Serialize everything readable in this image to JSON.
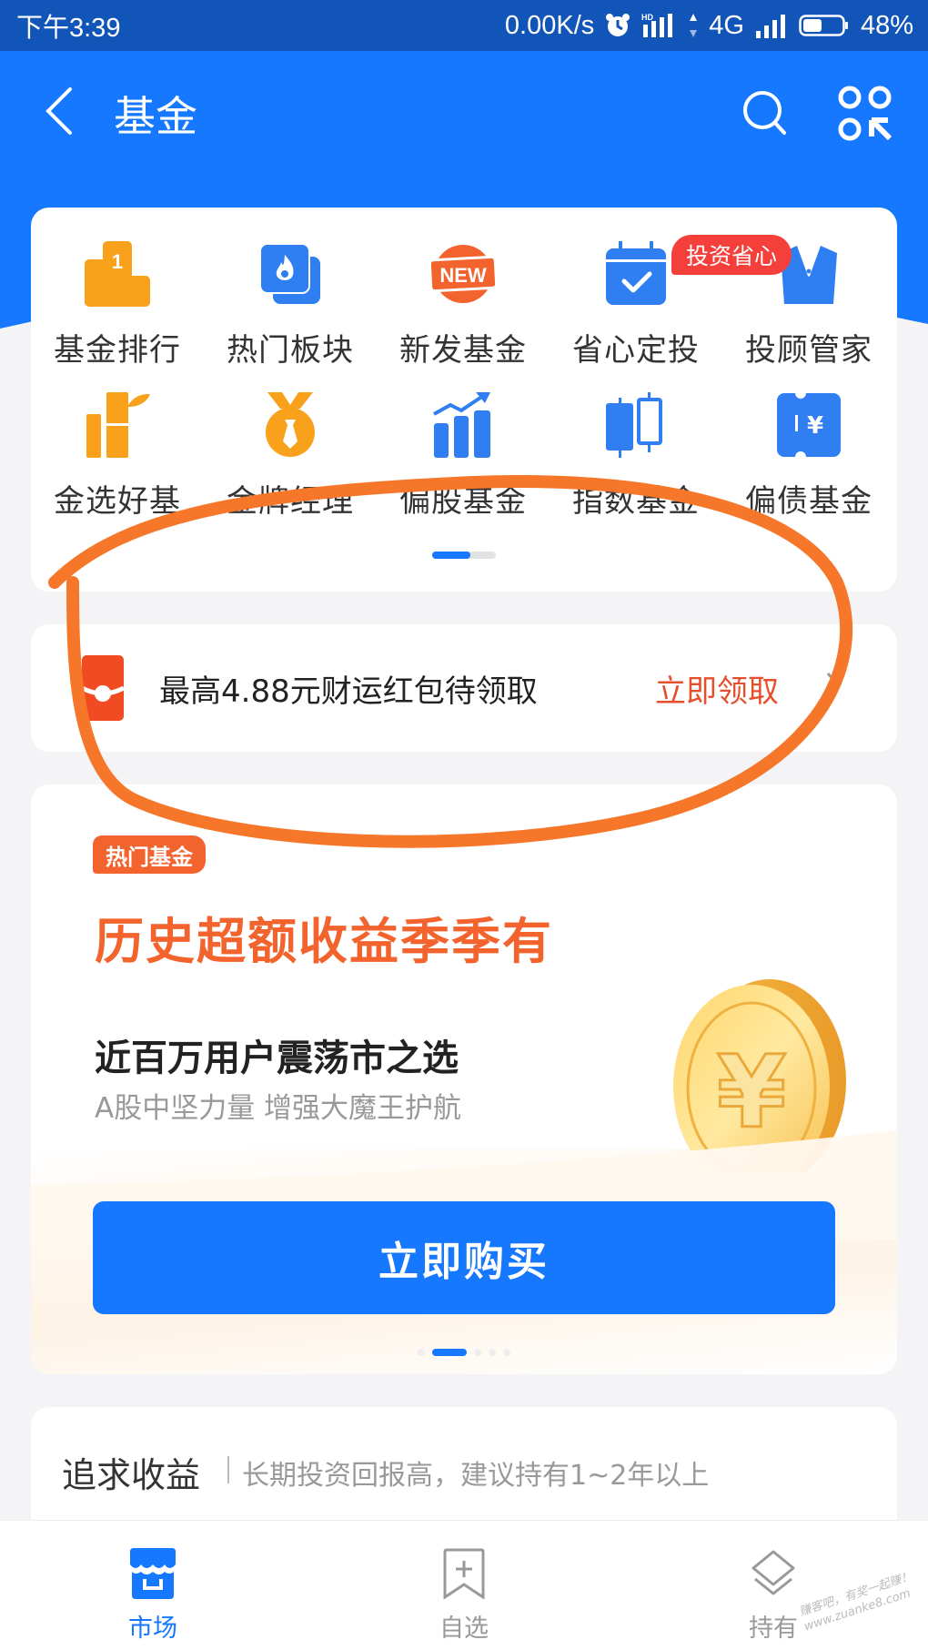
{
  "status_bar": {
    "time": "下午3:39",
    "net_speed": "0.00K/s",
    "network_type": "4G",
    "battery_percent": "48%",
    "battery_level": 0.48,
    "icons": [
      "alarm-icon",
      "hd-signal-icon",
      "data-arrows-icon",
      "signal-icon",
      "battery-icon"
    ]
  },
  "nav": {
    "title": "基金",
    "back_icon": "chevron-left-icon",
    "search_icon": "search-icon",
    "apps_icon": "apps-grid-icon"
  },
  "colors": {
    "brand_blue": "#1677ff",
    "accent_orange": "#f2632d",
    "badge_red": "#f43f3b",
    "icon_orange": "#f9a11b"
  },
  "quick_grid": {
    "badge": "投资省心",
    "page_indicator": {
      "pages": 2,
      "active": 1
    },
    "items": [
      {
        "label": "基金排行",
        "icon": "podium-rank-icon"
      },
      {
        "label": "热门板块",
        "icon": "flame-cards-icon"
      },
      {
        "label": "新发基金",
        "icon": "new-badge-icon",
        "icon_text": "NEW"
      },
      {
        "label": "省心定投",
        "icon": "calendar-check-icon"
      },
      {
        "label": "投顾管家",
        "icon": "suit-vest-icon"
      },
      {
        "label": "金选好基",
        "icon": "bamboo-icon"
      },
      {
        "label": "金牌经理",
        "icon": "medal-tie-icon"
      },
      {
        "label": "偏股基金",
        "icon": "bar-trend-icon"
      },
      {
        "label": "指数基金",
        "icon": "candlestick-icon"
      },
      {
        "label": "偏债基金",
        "icon": "yuan-ticket-icon",
        "icon_text": "¥"
      }
    ]
  },
  "promo": {
    "text": "最高4.88元财运红包待领取",
    "cta": "立即领取",
    "icon": "red-packet-icon"
  },
  "hot_fund": {
    "tag": "热门基金",
    "title": "历史超额收益季季有",
    "subtitle": "近百万用户震荡市之选",
    "description": "A股中坚力量 增强大魔王护航",
    "button": "立即购买",
    "carousel": {
      "count": 5,
      "active": 1
    },
    "illustration": "gold-yuan-coin"
  },
  "returns_section": {
    "title": "追求收益",
    "description": "长期投资回报高，建议持有1~2年以上"
  },
  "tabbar": {
    "items": [
      {
        "label": "市场",
        "icon": "storefront-icon",
        "active": true
      },
      {
        "label": "自选",
        "icon": "bookmark-add-icon",
        "active": false
      },
      {
        "label": "持有",
        "icon": "layers-icon",
        "active": false
      }
    ]
  },
  "watermark": {
    "line1": "赚客吧，有奖一起赚！",
    "line2": "www.zuanke8.com"
  }
}
